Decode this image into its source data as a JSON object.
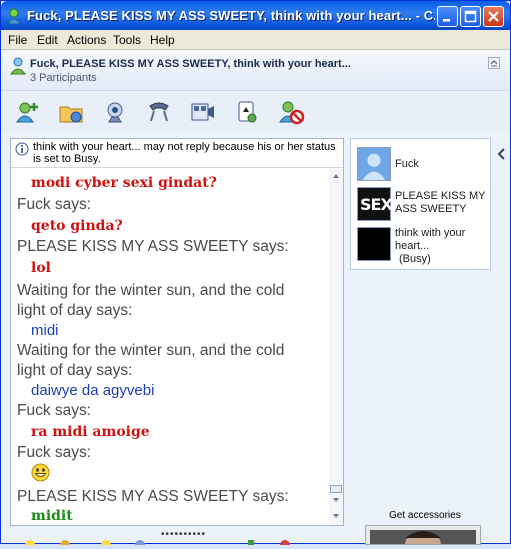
{
  "window": {
    "title": "Fuck, PLEASE KISS MY ASS SWEETY, think with your heart... - C..."
  },
  "menu": [
    "File",
    "Edit",
    "Actions",
    "Tools",
    "Help"
  ],
  "conversation": {
    "title": "Fuck, PLEASE KISS MY ASS SWEETY, think with your heart...",
    "participants_label": "3 Participants"
  },
  "toolbar": [
    {
      "icon": "invite-contact-icon"
    },
    {
      "icon": "send-files-icon"
    },
    {
      "icon": "webcam-icon"
    },
    {
      "icon": "call-icon"
    },
    {
      "icon": "video-icon"
    },
    {
      "icon": "games-icon"
    },
    {
      "icon": "block-icon"
    }
  ],
  "info_bar": {
    "text": "think with your heart... may not reply because his or her status is set to Busy."
  },
  "messages": [
    {
      "kind": "body",
      "style": "red",
      "text": "modi cyber sexi gindat?"
    },
    {
      "kind": "says",
      "text": "Fuck says:"
    },
    {
      "kind": "body",
      "style": "red",
      "text": "qeto ginda?"
    },
    {
      "kind": "says",
      "text": "PLEASE KISS MY ASS SWEETY says:"
    },
    {
      "kind": "body",
      "style": "red",
      "text": "lol"
    },
    {
      "kind": "says",
      "text": "Waiting for the winter sun, and the cold"
    },
    {
      "kind": "says",
      "text": "light of day says:"
    },
    {
      "kind": "body",
      "style": "blue",
      "text": "midi"
    },
    {
      "kind": "says",
      "text": "Waiting for the winter sun, and the cold"
    },
    {
      "kind": "says",
      "text": "light of day says:"
    },
    {
      "kind": "body",
      "style": "blue",
      "text": "daiwye da agyvebi"
    },
    {
      "kind": "says",
      "text": "Fuck says:"
    },
    {
      "kind": "body",
      "style": "red",
      "text": "ra midi amoige"
    },
    {
      "kind": "says",
      "text": "Fuck says:"
    },
    {
      "kind": "emoticon",
      "icon": "smiley-icon"
    },
    {
      "kind": "says",
      "text": "PLEASE KISS MY ASS SWEETY says:"
    },
    {
      "kind": "body",
      "style": "green",
      "text": "midit"
    }
  ],
  "participants": [
    {
      "name": "Fuck",
      "avatar": "default-user-avatar"
    },
    {
      "name": "PLEASE KISS MY ASS SWEETY",
      "avatar": "sex-avatar",
      "avatar_text": "SEX"
    },
    {
      "name": "think with your heart...",
      "status": "(Busy)",
      "avatar": "black-avatar"
    }
  ],
  "accessories": {
    "label": "Get accessories"
  },
  "colors": {
    "titlebar": "#0a5fe8",
    "red_text": "#d11010",
    "blue_text": "#1b3fb0",
    "green_text": "#1f8a16"
  }
}
